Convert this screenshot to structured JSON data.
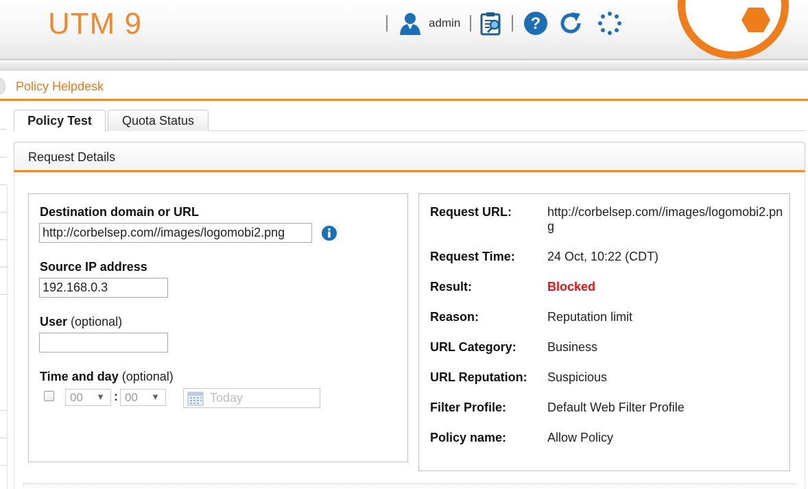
{
  "header": {
    "app_title": "UTM 9",
    "user_name": "admin",
    "icons": [
      "user-icon",
      "clipboard-search-icon",
      "help-icon",
      "reload-icon",
      "spinner-icon"
    ],
    "accent": "#ee8a2e"
  },
  "page": {
    "title": "Policy Helpdesk"
  },
  "tabs": [
    {
      "label": "Policy Test",
      "active": true
    },
    {
      "label": "Quota Status",
      "active": false
    }
  ],
  "panel": {
    "title": "Request Details"
  },
  "form": {
    "destination": {
      "label": "Destination domain or URL",
      "value": "http://corbelsep.com//images/logomobi2.png"
    },
    "source_ip": {
      "label": "Source IP address",
      "value": "192.168.0.3"
    },
    "user": {
      "label": "User",
      "optional": "(optional)",
      "value": ""
    },
    "time_day": {
      "label": "Time and day",
      "optional": "(optional)",
      "hour": "00",
      "minute": "00",
      "separator": ":",
      "date_placeholder": "Today",
      "checked": false
    }
  },
  "result": {
    "rows": [
      {
        "label": "Request URL:",
        "value": "http://corbelsep.com//images/logomobi2.png"
      },
      {
        "label": "Request Time:",
        "value": "24 Oct, 10:22 (CDT)"
      },
      {
        "label": "Result:",
        "value": "Blocked",
        "color": "#e01515"
      },
      {
        "label": "Reason:",
        "value": "Reputation limit"
      },
      {
        "label": "URL Category:",
        "value": "Business"
      },
      {
        "label": "URL Reputation:",
        "value": "Suspicious"
      },
      {
        "label": "Filter Profile:",
        "value": "Default Web Filter Profile"
      },
      {
        "label": "Policy name:",
        "value": "Allow Policy"
      }
    ]
  }
}
